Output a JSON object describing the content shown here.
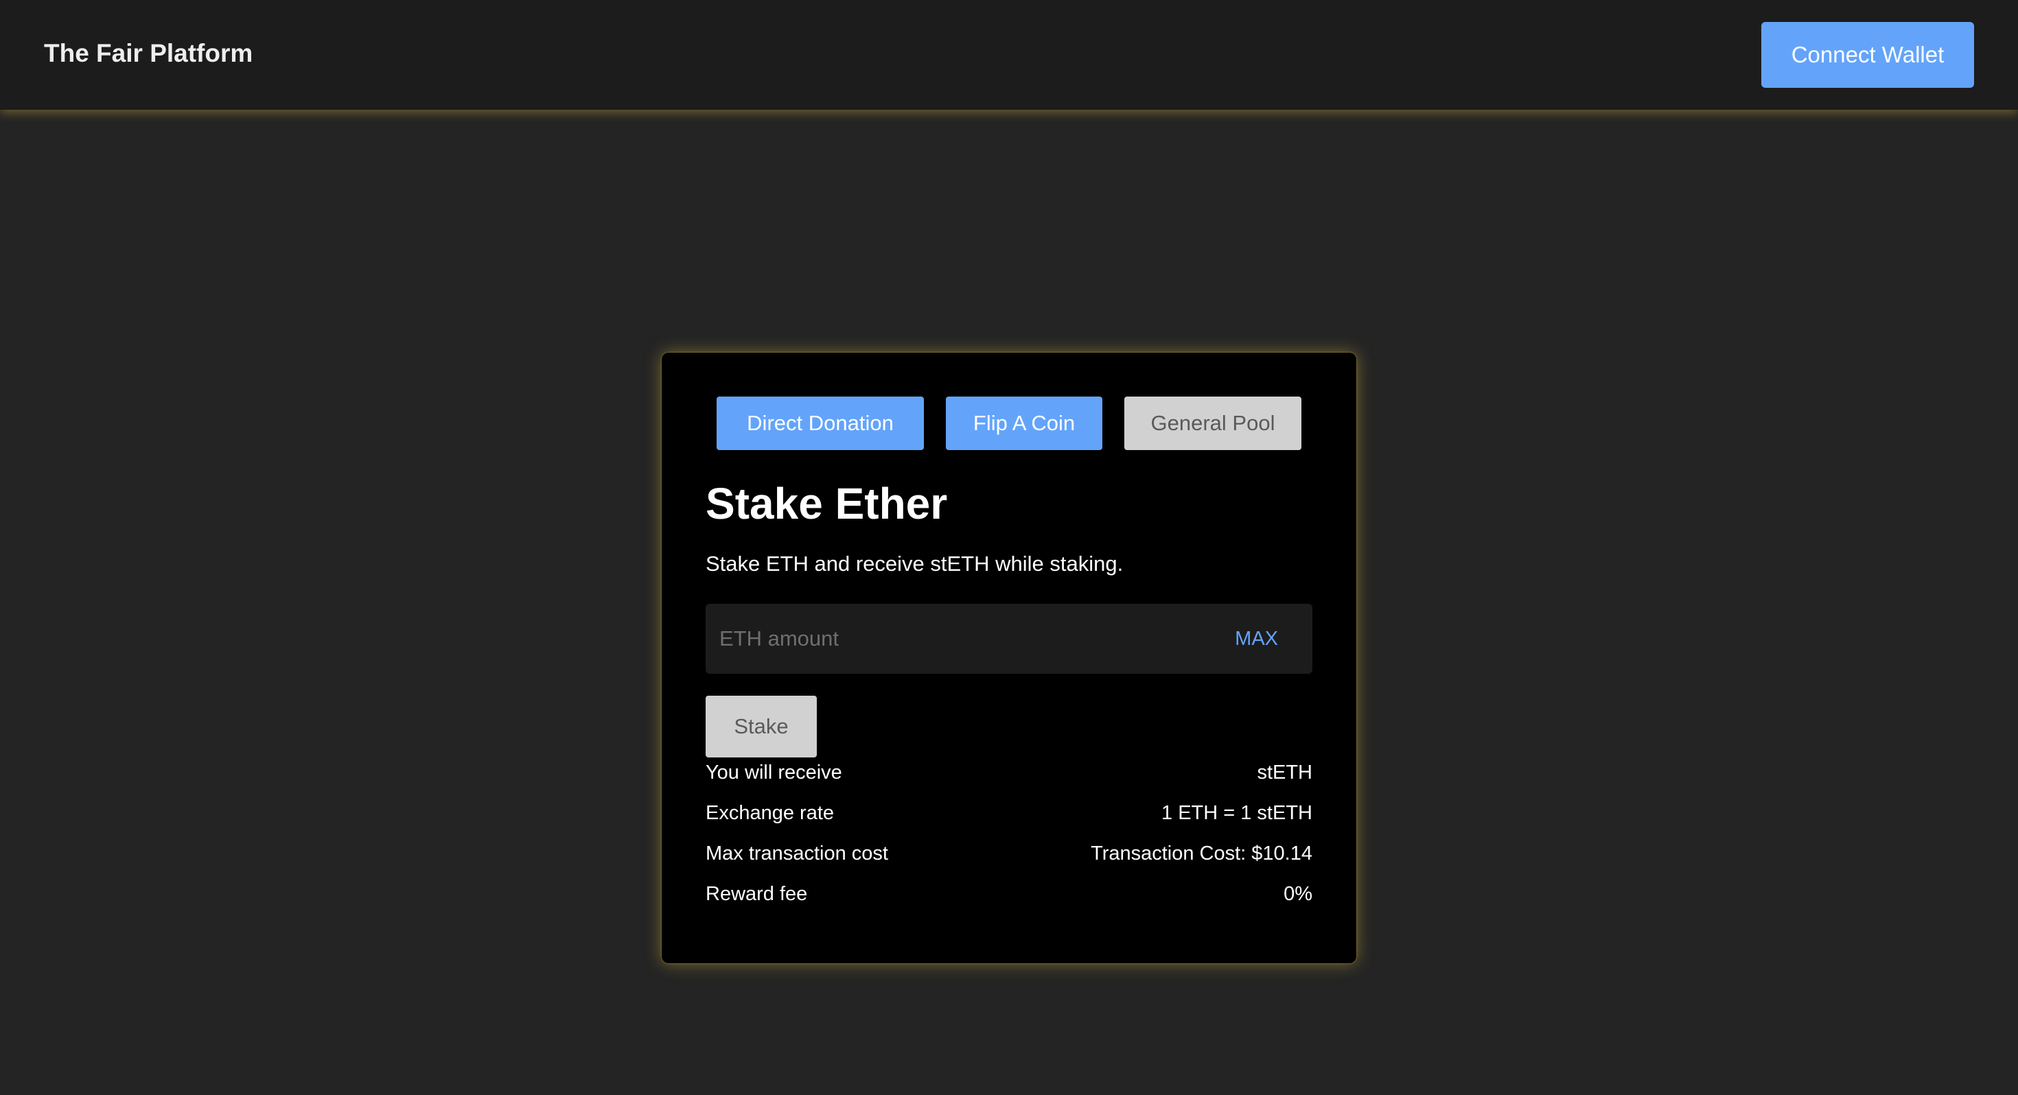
{
  "header": {
    "brand": "The Fair Platform",
    "connect_label": "Connect Wallet"
  },
  "tabs": [
    {
      "label": "Direct Donation",
      "state": "inactive"
    },
    {
      "label": "Flip A Coin",
      "state": "inactive"
    },
    {
      "label": "General Pool",
      "state": "active"
    }
  ],
  "stake": {
    "title": "Stake Ether",
    "subtitle": "Stake ETH and receive stETH while staking.",
    "amount_placeholder": "ETH amount",
    "amount_value": "",
    "max_label": "MAX",
    "submit_label": "Stake"
  },
  "info": [
    {
      "label": "You will receive",
      "value": "stETH"
    },
    {
      "label": "Exchange rate",
      "value": "1 ETH = 1 stETH"
    },
    {
      "label": "Max transaction cost",
      "value": "Transaction Cost: $10.14"
    },
    {
      "label": "Reward fee",
      "value": "0%"
    }
  ],
  "colors": {
    "background": "#242424",
    "header": "#1c1c1c",
    "accent_blue": "#63a4fa",
    "glow_gold": "#c9a83c",
    "card": "#000000",
    "disabled_grey": "#d1d1d1"
  }
}
